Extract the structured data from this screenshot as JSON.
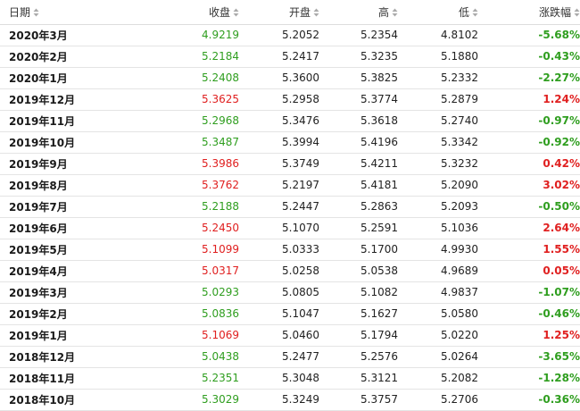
{
  "colors": {
    "up": "#e02020",
    "down": "#2f9e1f",
    "sort_icon": "#aaaaaa"
  },
  "columns": [
    {
      "key": "date",
      "label": "日期",
      "sort_icon": "sort-icon"
    },
    {
      "key": "close",
      "label": "收盘",
      "sort_icon": "sort-icon"
    },
    {
      "key": "open",
      "label": "开盘",
      "sort_icon": "sort-icon"
    },
    {
      "key": "high",
      "label": "高",
      "sort_icon": "sort-icon"
    },
    {
      "key": "low",
      "label": "低",
      "sort_icon": "sort-icon"
    },
    {
      "key": "change",
      "label": "涨跌幅",
      "sort_icon": "sort-icon"
    }
  ],
  "rows": [
    {
      "date": "2020年3月",
      "close": "4.9219",
      "open": "5.2052",
      "high": "5.2354",
      "low": "4.8102",
      "change": "-5.68%",
      "direction": "down"
    },
    {
      "date": "2020年2月",
      "close": "5.2184",
      "open": "5.2417",
      "high": "5.3235",
      "low": "5.1880",
      "change": "-0.43%",
      "direction": "down"
    },
    {
      "date": "2020年1月",
      "close": "5.2408",
      "open": "5.3600",
      "high": "5.3825",
      "low": "5.2332",
      "change": "-2.27%",
      "direction": "down"
    },
    {
      "date": "2019年12月",
      "close": "5.3625",
      "open": "5.2958",
      "high": "5.3774",
      "low": "5.2879",
      "change": "1.24%",
      "direction": "up"
    },
    {
      "date": "2019年11月",
      "close": "5.2968",
      "open": "5.3476",
      "high": "5.3618",
      "low": "5.2740",
      "change": "-0.97%",
      "direction": "down"
    },
    {
      "date": "2019年10月",
      "close": "5.3487",
      "open": "5.3994",
      "high": "5.4196",
      "low": "5.3342",
      "change": "-0.92%",
      "direction": "down"
    },
    {
      "date": "2019年9月",
      "close": "5.3986",
      "open": "5.3749",
      "high": "5.4211",
      "low": "5.3232",
      "change": "0.42%",
      "direction": "up"
    },
    {
      "date": "2019年8月",
      "close": "5.3762",
      "open": "5.2197",
      "high": "5.4181",
      "low": "5.2090",
      "change": "3.02%",
      "direction": "up"
    },
    {
      "date": "2019年7月",
      "close": "5.2188",
      "open": "5.2447",
      "high": "5.2863",
      "low": "5.2093",
      "change": "-0.50%",
      "direction": "down"
    },
    {
      "date": "2019年6月",
      "close": "5.2450",
      "open": "5.1070",
      "high": "5.2591",
      "low": "5.1036",
      "change": "2.64%",
      "direction": "up"
    },
    {
      "date": "2019年5月",
      "close": "5.1099",
      "open": "5.0333",
      "high": "5.1700",
      "low": "4.9930",
      "change": "1.55%",
      "direction": "up"
    },
    {
      "date": "2019年4月",
      "close": "5.0317",
      "open": "5.0258",
      "high": "5.0538",
      "low": "4.9689",
      "change": "0.05%",
      "direction": "up"
    },
    {
      "date": "2019年3月",
      "close": "5.0293",
      "open": "5.0805",
      "high": "5.1082",
      "low": "4.9837",
      "change": "-1.07%",
      "direction": "down"
    },
    {
      "date": "2019年2月",
      "close": "5.0836",
      "open": "5.1047",
      "high": "5.1627",
      "low": "5.0580",
      "change": "-0.46%",
      "direction": "down"
    },
    {
      "date": "2019年1月",
      "close": "5.1069",
      "open": "5.0460",
      "high": "5.1794",
      "low": "5.0220",
      "change": "1.25%",
      "direction": "up"
    },
    {
      "date": "2018年12月",
      "close": "5.0438",
      "open": "5.2477",
      "high": "5.2576",
      "low": "5.0264",
      "change": "-3.65%",
      "direction": "down"
    },
    {
      "date": "2018年11月",
      "close": "5.2351",
      "open": "5.3048",
      "high": "5.3121",
      "low": "5.2082",
      "change": "-1.28%",
      "direction": "down"
    },
    {
      "date": "2018年10月",
      "close": "5.3029",
      "open": "5.3249",
      "high": "5.3757",
      "low": "5.2706",
      "change": "-0.36%",
      "direction": "down"
    }
  ]
}
